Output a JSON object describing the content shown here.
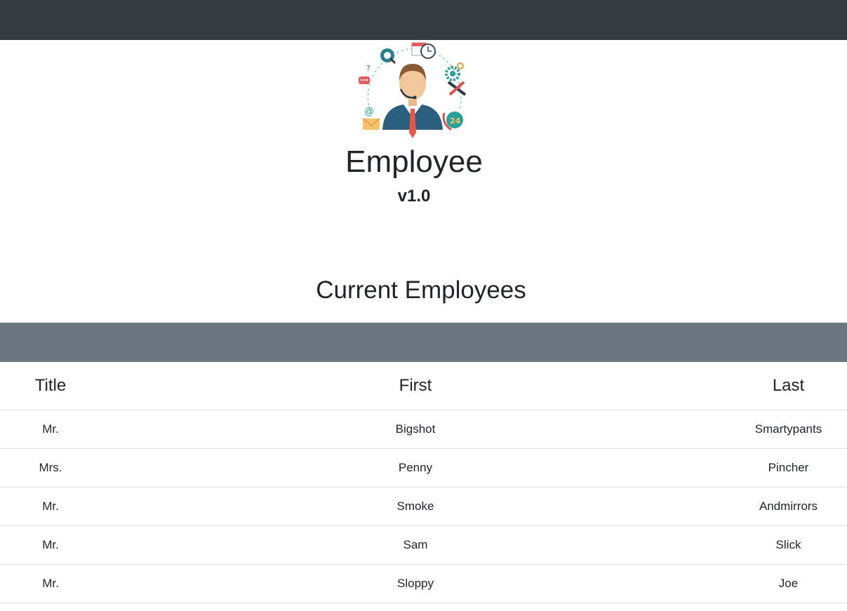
{
  "header": {
    "app_title": "Employee",
    "version": "v1.0"
  },
  "logo": {
    "icon": "support-agent-illustration",
    "badge_text": "24"
  },
  "section_title": "Current Employees",
  "table": {
    "columns": [
      "Title",
      "First",
      "Last"
    ],
    "rows": [
      [
        "Mr.",
        "Bigshot",
        "Smartypants"
      ],
      [
        "Mrs.",
        "Penny",
        "Pincher"
      ],
      [
        "Mr.",
        "Smoke",
        "Andmirrors"
      ],
      [
        "Mr.",
        "Sam",
        "Slick"
      ],
      [
        "Mr.",
        "Sloppy",
        "Joe"
      ]
    ]
  },
  "colors": {
    "navbar": "#343a40",
    "table_band": "#6c757d",
    "text": "#212529",
    "row_border": "#dee2e6"
  }
}
